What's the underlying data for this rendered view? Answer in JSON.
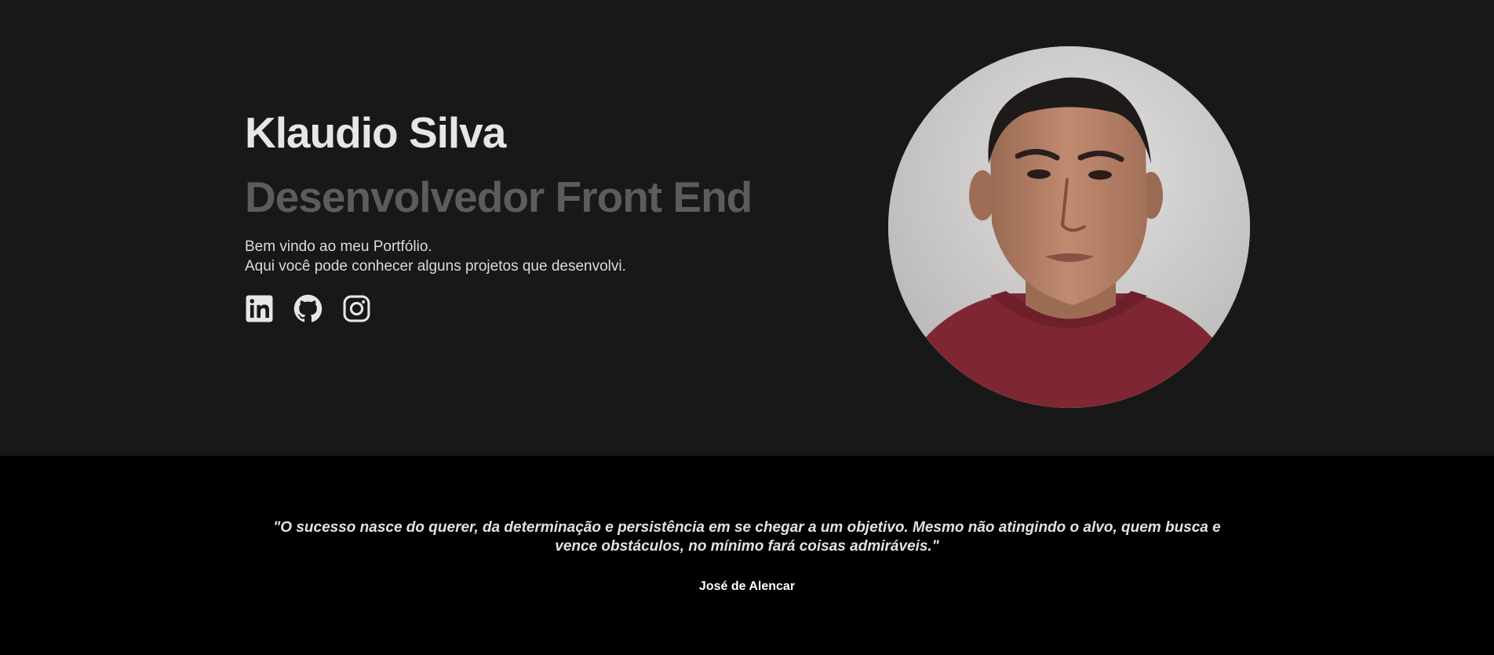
{
  "hero": {
    "name": "Klaudio Silva",
    "role": "Desenvolvedor Front End",
    "intro_line_1": "Bem vindo ao meu Portfólio.",
    "intro_line_2": "Aqui você pode conhecer alguns projetos que desenvolvi.",
    "socials": [
      {
        "icon": "linkedin-icon"
      },
      {
        "icon": "github-icon"
      },
      {
        "icon": "instagram-icon"
      }
    ],
    "avatar": {
      "icon": "profile-photo"
    }
  },
  "quote_section": {
    "quote": "\"O sucesso nasce do querer, da determinação e persistência em se chegar a um objetivo. Mesmo não atingindo o alvo, quem busca e vence obstáculos, no mínimo fará coisas admiráveis.\"",
    "author": "José de Alencar"
  },
  "colors": {
    "hero_background": "#181818",
    "quote_background": "#000000",
    "name_text": "#e6e6e6",
    "role_text": "#5c5c5c",
    "body_text": "#dcdcdc"
  }
}
